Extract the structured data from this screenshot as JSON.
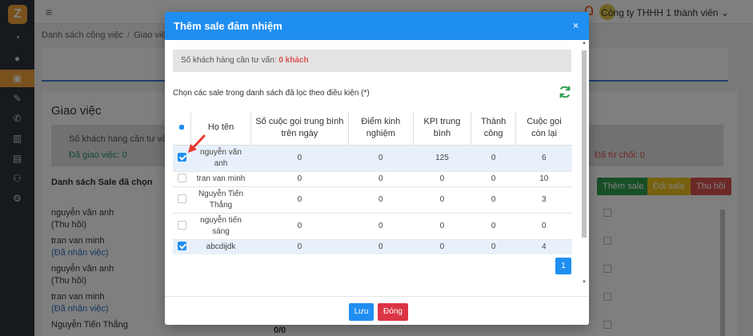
{
  "app": {
    "logo_letter": "Z",
    "company": "Công ty THHH 1 thành viên"
  },
  "breadcrumb": {
    "parent": "Danh sách công việc",
    "sep": "/",
    "current": "Giao việc"
  },
  "page": {
    "title": "Giao việc",
    "stats": {
      "customers_label": "Số khách hàng cần tư vấn: 0",
      "assigned_label": "Đã giao việc: 0",
      "rejected_label": "Đã từ chối: 0"
    },
    "chosen_title": "Danh sách Sale đã chọn",
    "buttons": {
      "add": "Thêm sale",
      "change": "Đổi sale",
      "revoke": "Thu hồi"
    },
    "chosen_sales": [
      {
        "name": "nguyễn văn anh",
        "status": "(Thu hồi)",
        "link": false
      },
      {
        "name": "tran van minh",
        "status": "(Đã nhận việc)",
        "link": true
      },
      {
        "name": "nguyễn văn anh",
        "status": "(Thu hồi)",
        "link": false
      },
      {
        "name": "tran van minh",
        "status": "(Đã nhận việc)",
        "link": true
      },
      {
        "name": "Nguyễn Tiến Thắng",
        "status": "",
        "link": false
      }
    ],
    "bottom_value": "0/0"
  },
  "modal": {
    "title": "Thêm sale đảm nhiệm",
    "close": "×",
    "info_prefix": "Số khách hàng cần tư vấn:",
    "info_value": "0 khách",
    "choose_label": "Chọn các sale trong danh sách đã lọc theo điều kiện (*)",
    "columns": [
      "Họ tên",
      "Số cuộc gọi trung bình trên ngày",
      "Điểm kinh nghiệm",
      "KPI trung bình",
      "Thành công",
      "Cuộc gọi còn lại"
    ],
    "rows": [
      {
        "checked": true,
        "name": "nguyễn văn anh",
        "calls": "0",
        "exp": "0",
        "kpi": "125",
        "success": "0",
        "remaining": "6"
      },
      {
        "checked": false,
        "name": "tran van minh",
        "calls": "0",
        "exp": "0",
        "kpi": "0",
        "success": "0",
        "remaining": "10"
      },
      {
        "checked": false,
        "name": "Nguyễn Tiến Thắng",
        "calls": "0",
        "exp": "0",
        "kpi": "0",
        "success": "0",
        "remaining": "3"
      },
      {
        "checked": false,
        "name": "nguyễn tiến sáng",
        "calls": "0",
        "exp": "0",
        "kpi": "0",
        "success": "0",
        "remaining": "0"
      },
      {
        "checked": true,
        "name": "abcdijdk",
        "calls": "0",
        "exp": "0",
        "kpi": "0",
        "success": "0",
        "remaining": "4"
      }
    ],
    "page": "1",
    "save_label": "Lưu",
    "cancel_label": "Đóng"
  },
  "colors": {
    "primary": "#1f8ef1",
    "sidebar": "#2c323a",
    "accent": "#f2a33a",
    "danger": "#dc3545",
    "success": "#2e9e4f"
  }
}
